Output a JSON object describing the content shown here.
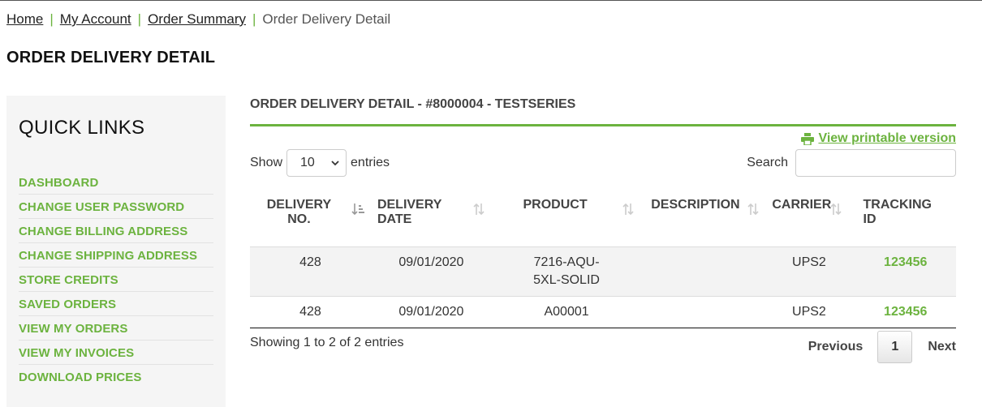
{
  "breadcrumb": {
    "items": [
      "Home",
      "My Account",
      "Order Summary"
    ],
    "current": "Order Delivery Detail",
    "separator": "|"
  },
  "page_title": "ORDER DELIVERY DETAIL",
  "sidebar": {
    "title": "QUICK LINKS",
    "items": [
      {
        "label": "DASHBOARD"
      },
      {
        "label": "CHANGE USER PASSWORD"
      },
      {
        "label": "CHANGE BILLING ADDRESS"
      },
      {
        "label": "CHANGE SHIPPING ADDRESS"
      },
      {
        "label": "STORE CREDITS"
      },
      {
        "label": "SAVED ORDERS"
      },
      {
        "label": "VIEW MY ORDERS"
      },
      {
        "label": "VIEW MY INVOICES"
      },
      {
        "label": "DOWNLOAD PRICES"
      }
    ]
  },
  "main": {
    "section_title": "ORDER DELIVERY DETAIL - #8000004 - TESTSERIES",
    "printable_label": "View printable version",
    "printable_icon": "print-icon",
    "show_label": "Show",
    "entries_label": "entries",
    "page_size": "10",
    "search_label": "Search",
    "search_value": ""
  },
  "table": {
    "headers": [
      "DELIVERY NO.",
      "DELIVERY DATE",
      "PRODUCT",
      "DESCRIPTION",
      "CARRIER",
      "TRACKING ID"
    ],
    "rows": [
      [
        "428",
        "09/01/2020",
        "7216-AQU-5XL-SOLID",
        "",
        "UPS2",
        "123456"
      ],
      [
        "428",
        "09/01/2020",
        "A00001",
        "",
        "UPS2",
        "123456"
      ]
    ]
  },
  "pagination": {
    "info": "Showing 1 to 2 of 2 entries",
    "previous": "Previous",
    "current_page": "1",
    "next": "Next"
  },
  "colors": {
    "accent": "#6cb33f",
    "sidebar_bg": "#f5f5f5",
    "row_stripe": "#f3f3f3"
  }
}
